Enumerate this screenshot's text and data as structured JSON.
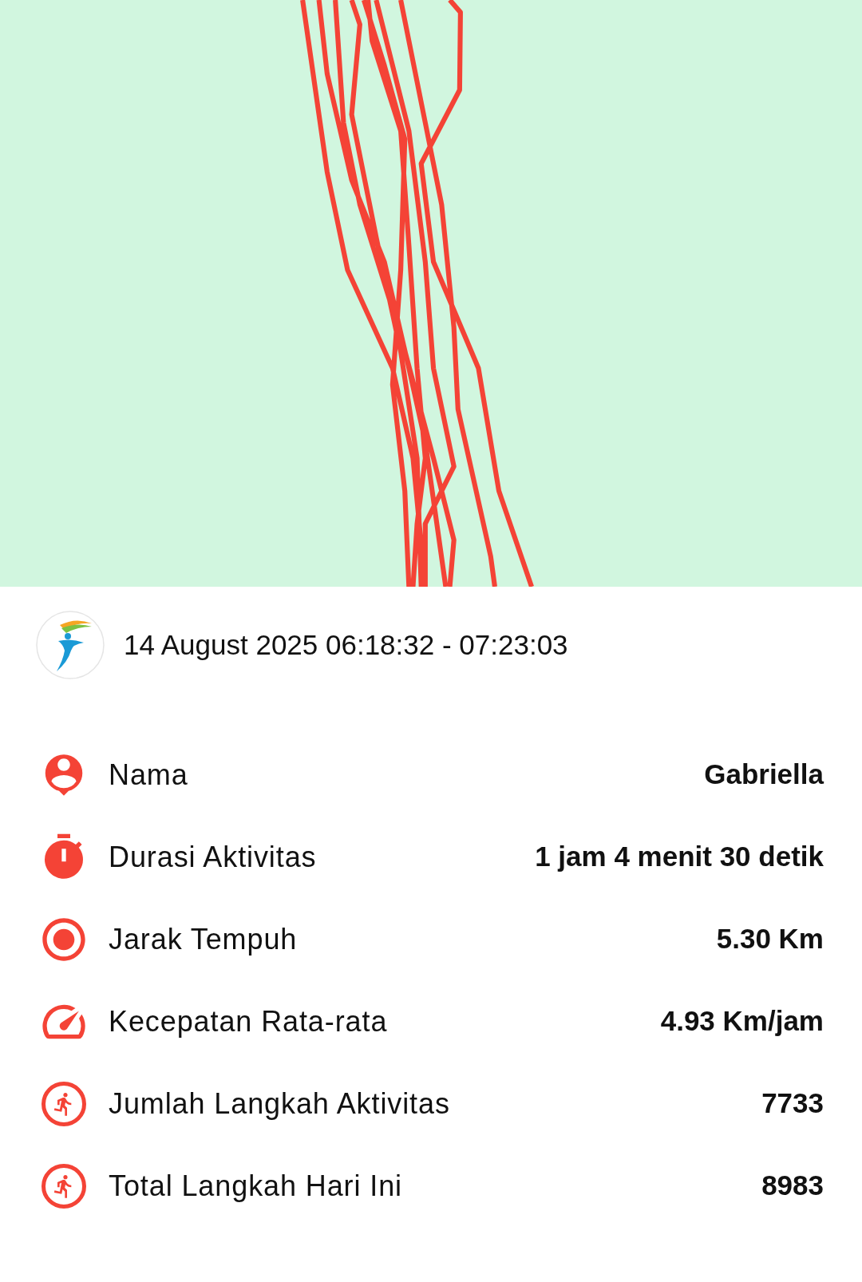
{
  "activity": {
    "datetime": "14 August 2025 06:18:32 - 07:23:03"
  },
  "stats": [
    {
      "kind": "person",
      "label": "Nama",
      "value": "Gabriella"
    },
    {
      "kind": "timer",
      "label": "Durasi Aktivitas",
      "value": "1 jam 4 menit 30 detik"
    },
    {
      "kind": "target",
      "label": "Jarak Tempuh",
      "value": "5.30 Km"
    },
    {
      "kind": "speed",
      "label": "Kecepatan Rata-rata",
      "value": "4.93 Km/jam"
    },
    {
      "kind": "steps",
      "label": "Jumlah Langkah Aktivitas",
      "value": "7733"
    },
    {
      "kind": "steps",
      "label": "Total Langkah Hari Ini",
      "value": "8983"
    }
  ]
}
